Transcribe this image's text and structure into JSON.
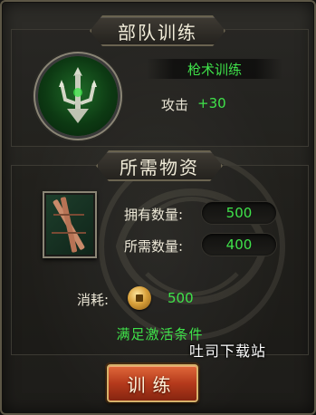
{
  "unit_training": {
    "title": "部队训练",
    "skill_name": "枪术训练",
    "stat_label": "攻击",
    "stat_value": "+30"
  },
  "materials": {
    "title": "所需物资",
    "owned_label": "拥有数量:",
    "owned_value": "500",
    "required_label": "所需数量:",
    "required_value": "400",
    "cost_label": "消耗:",
    "cost_value": "500",
    "condition_text": "满足激活条件"
  },
  "watermark": "吐司下载站",
  "actions": {
    "train_label": "训练"
  },
  "icons": {
    "skill": "spear-trident-icon",
    "item": "bamboo-sticks-icon",
    "currency": "copper-coin-icon"
  },
  "colors": {
    "highlight_green": "#3fe24a",
    "button_orange": "#b53a1c",
    "text_light": "#ece7d6"
  }
}
